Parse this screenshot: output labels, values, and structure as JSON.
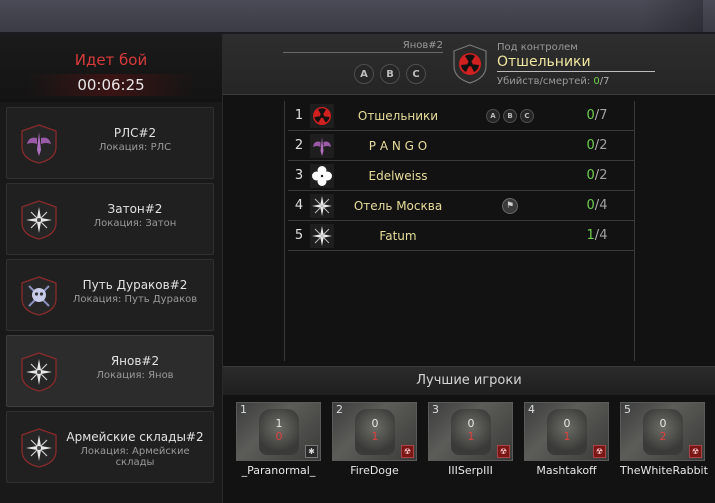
{
  "battle": {
    "status": "Идет бой",
    "timer": "00:06:25"
  },
  "locations": [
    {
      "name": "РЛС#2",
      "location": "Локация: РЛС",
      "emblem": "winged-dagger-icon",
      "active": false
    },
    {
      "name": "Затон#2",
      "location": "Локация: Затон",
      "emblem": "compass-star-icon",
      "active": false
    },
    {
      "name": "Путь Дураков#2",
      "location": "Локация: Путь Дураков",
      "emblem": "skull-crossed-icon",
      "active": false
    },
    {
      "name": "Янов#2",
      "location": "Локация: Янов",
      "emblem": "compass-star-icon",
      "active": true
    },
    {
      "name": "Армейские склады#2",
      "location": "Локация: Армейские склады",
      "emblem": "compass-star-icon",
      "active": false
    }
  ],
  "header": {
    "location": "Янов#2",
    "points": [
      "A",
      "B",
      "C"
    ],
    "control_label": "Под контролем",
    "control_name": "Отшельники",
    "kd_label": "Убийств/смертей:",
    "kills": "0",
    "deaths": "7"
  },
  "clans": [
    {
      "rank": "1",
      "name": "Отшельники",
      "emblem": "radiation-icon",
      "points": [
        "A",
        "B",
        "C"
      ],
      "flag": false,
      "kills": "0",
      "deaths": "7"
    },
    {
      "rank": "2",
      "name": "P A N G O",
      "emblem": "winged-dagger-icon",
      "points": [],
      "flag": false,
      "kills": "0",
      "deaths": "2"
    },
    {
      "rank": "3",
      "name": "Edelweiss",
      "emblem": "clover-icon",
      "points": [],
      "flag": false,
      "kills": "0",
      "deaths": "2"
    },
    {
      "rank": "4",
      "name": "Отель Москва",
      "emblem": "compass-star-icon",
      "points": [],
      "flag": true,
      "kills": "0",
      "deaths": "4"
    },
    {
      "rank": "5",
      "name": "Fatum",
      "emblem": "compass-star-icon",
      "points": [],
      "flag": false,
      "kills": "1",
      "deaths": "4"
    }
  ],
  "best_title": "Лучшие игроки",
  "players": [
    {
      "rank": "1",
      "name": "_Paranormal_",
      "kills": "1",
      "deaths": "0",
      "badge": "snowflake-icon"
    },
    {
      "rank": "2",
      "name": "FireDoge",
      "kills": "0",
      "deaths": "1",
      "badge": "radiation-icon"
    },
    {
      "rank": "3",
      "name": "IIISerpIII",
      "kills": "0",
      "deaths": "1",
      "badge": "radiation-icon"
    },
    {
      "rank": "4",
      "name": "Mashtakoff",
      "kills": "0",
      "deaths": "1",
      "badge": "radiation-icon"
    },
    {
      "rank": "5",
      "name": "TheWhiteRabbit",
      "kills": "0",
      "deaths": "2",
      "badge": "radiation-icon"
    }
  ],
  "colors": {
    "accent_red": "#d83a3a",
    "gold": "#e8dd9a",
    "kills_green": "#6fcf4e",
    "deaths_red": "#e04040"
  }
}
